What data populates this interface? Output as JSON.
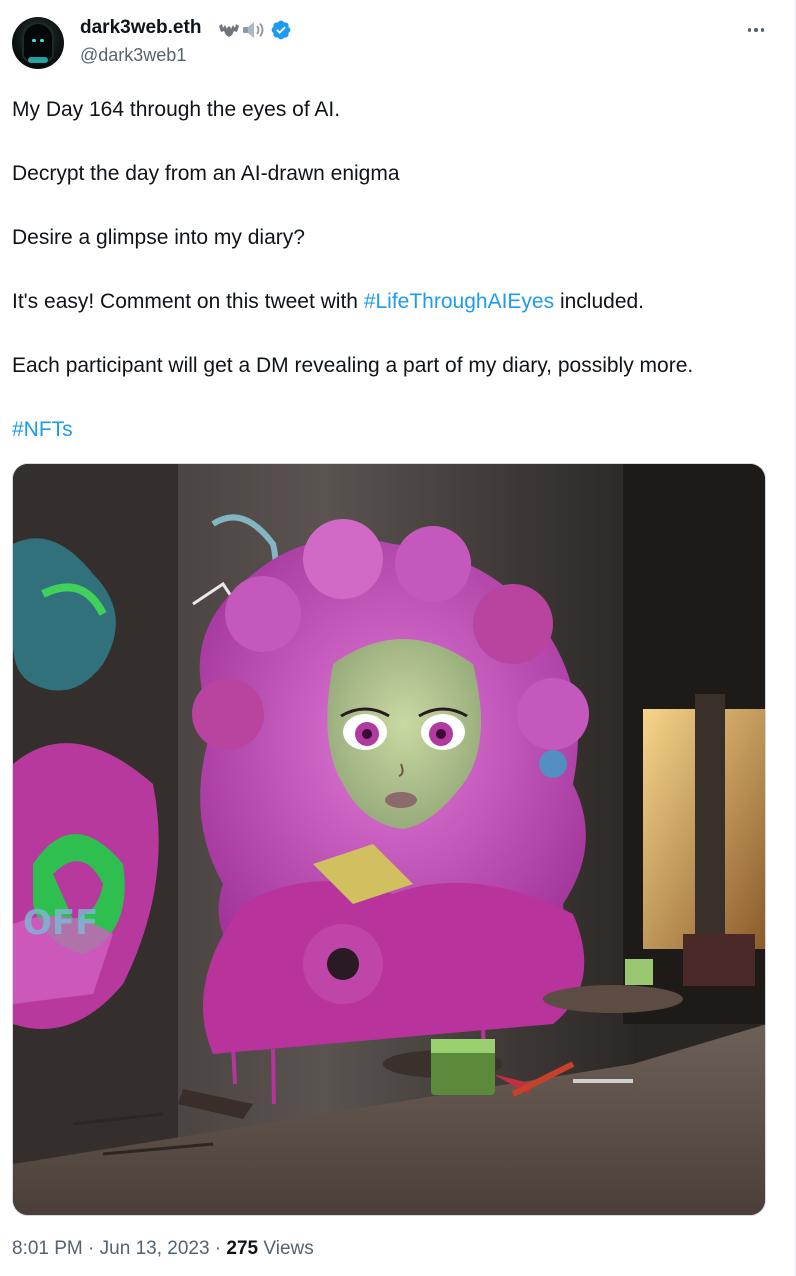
{
  "author": {
    "display_name": "dark3web.eth",
    "handle": "@dark3web1",
    "avatar_icon": "hooded-figure-avatar",
    "name_icons": [
      "bat-icon",
      "speaker-icon",
      "verified-badge-icon"
    ],
    "verified_color": "#1d9bf0"
  },
  "menu": {
    "more_icon": "more-options-icon"
  },
  "tweet": {
    "line1": "My Day 164 through the eyes of AI.",
    "line2": "Decrypt the day from an AI-drawn enigma",
    "line3": "Desire a glimpse into my diary?",
    "line4_before": "It's easy! Comment on this tweet with ",
    "line4_hashtag": "#LifeThroughAIEyes",
    "line4_after": " included.",
    "line5": "Each participant will get a DM revealing a part of my diary, possibly more.",
    "hashtag_nfts": "#NFTs"
  },
  "media": {
    "kind": "image",
    "subject": "graffiti-mural-pink-haired-girl"
  },
  "footer": {
    "time": "8:01 PM",
    "separator1": " · ",
    "date": "Jun 13, 2023",
    "separator2": " · ",
    "views_count": "275",
    "views_label": " Views"
  },
  "colors": {
    "text": "#0f1419",
    "secondary": "#536471",
    "link": "#1d9bf0"
  }
}
